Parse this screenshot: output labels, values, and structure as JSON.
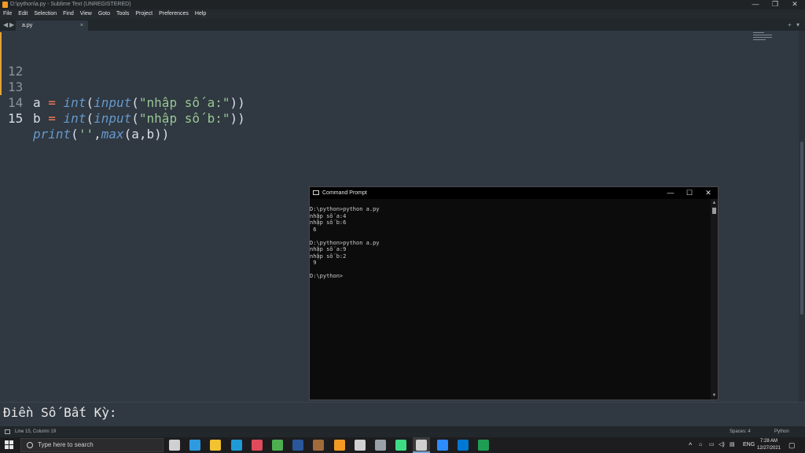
{
  "window": {
    "title": "D:\\python\\a.py - Sublime Text (UNREGISTERED)",
    "minimize": "—",
    "restore": "❐",
    "close": "✕"
  },
  "menu": [
    "File",
    "Edit",
    "Selection",
    "Find",
    "View",
    "Goto",
    "Tools",
    "Project",
    "Preferences",
    "Help"
  ],
  "tabs": {
    "back": "◀",
    "forward": "▶",
    "active_tab": "a.py",
    "close": "×",
    "new_tab": "+",
    "tab_list": "▾"
  },
  "editor": {
    "lines": [
      {
        "number": "12"
      },
      {
        "number": "13"
      },
      {
        "number": "14"
      },
      {
        "number": "15"
      }
    ],
    "line13": {
      "var": "a",
      "eq": " = ",
      "int": "int",
      "lp": "(",
      "input": "input",
      "lp2": "(",
      "str": "\"nhập số a:\"",
      "rp": "))"
    },
    "line14": {
      "var": "b",
      "eq": " = ",
      "int": "int",
      "lp": "(",
      "input": "input",
      "lp2": "(",
      "str": "\"nhập số b:\"",
      "rp": "))"
    },
    "line15": {
      "print": "print",
      "lp": "(",
      "str": "''",
      "comma": ",",
      "max": "max",
      "args": "(a,b))"
    }
  },
  "console": {
    "text": "Điền Số Bất Kỳ:"
  },
  "status": {
    "position": "Line 15, Column 19",
    "spaces": "Spaces: 4",
    "syntax": "Python"
  },
  "cmd": {
    "title": "Command Prompt",
    "minimize": "—",
    "maximize": "☐",
    "close": "✕",
    "output": "D:\\python>python a.py\nnhập số a:4\nnhập số b:6\n 6\n\nD:\\python>python a.py\nnhập số a:9\nnhập số b:2\n 9\n\nD:\\python>"
  },
  "taskbar": {
    "search_placeholder": "Type here to search",
    "time": "7:28 AM",
    "date": "12/27/2021",
    "language": "ENG",
    "tray_chevron": "^",
    "apps": [
      {
        "name": "task-view",
        "color": "#d0d0d0"
      },
      {
        "name": "edge",
        "color": "#2e9be0"
      },
      {
        "name": "file-explorer",
        "color": "#f2c230"
      },
      {
        "name": "skype",
        "color": "#1e9bd7"
      },
      {
        "name": "app-grid",
        "color": "#e04a5a"
      },
      {
        "name": "chrome",
        "color": "#4caf50"
      },
      {
        "name": "word",
        "color": "#2b579a"
      },
      {
        "name": "package",
        "color": "#a26a3a"
      },
      {
        "name": "sublime",
        "color": "#f29a23"
      },
      {
        "name": "settings",
        "color": "#d0d0d0"
      },
      {
        "name": "snipping",
        "color": "#9aa0a6"
      },
      {
        "name": "android",
        "color": "#3ddc84"
      },
      {
        "name": "terminal",
        "color": "#cfcfcf"
      },
      {
        "name": "zoom",
        "color": "#2d8cff"
      },
      {
        "name": "mail",
        "color": "#0078d4"
      },
      {
        "name": "excel-app",
        "color": "#1f9d55"
      }
    ]
  }
}
